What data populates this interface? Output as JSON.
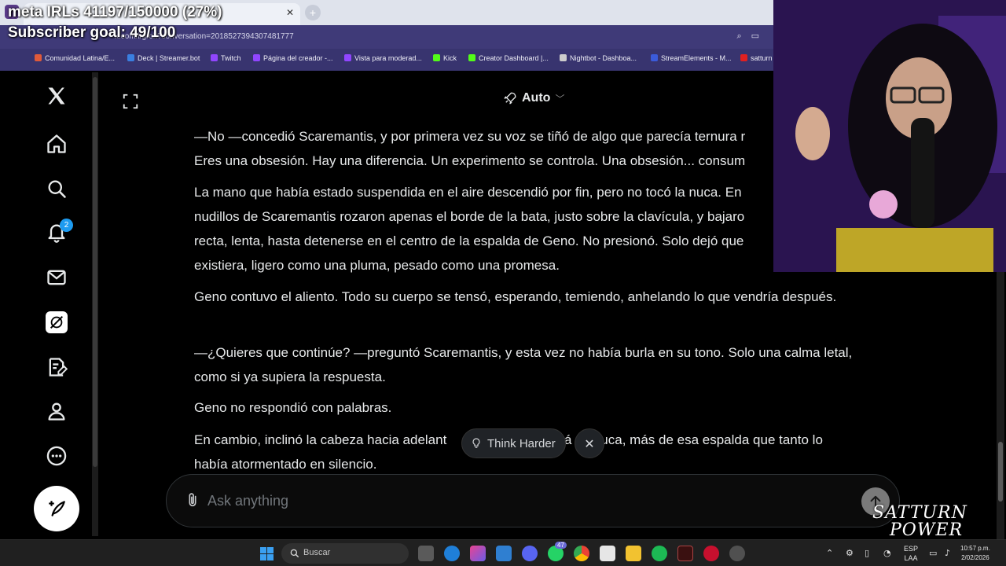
{
  "overlay": {
    "meta": "meta IRLs 41197/150000 (27%)",
    "subscriber_goal": "Subscriber goal: 49/100"
  },
  "browser": {
    "url": "x.com/i/grok?conversation=2018527394307481777",
    "bookmarks": [
      {
        "label": "Comunidad Latina/E...",
        "color": "#e05a3a"
      },
      {
        "label": "Deck | Streamer.bot",
        "color": "#3a7fe0"
      },
      {
        "label": "Twitch",
        "color": "#9146ff"
      },
      {
        "label": "Página del creador -...",
        "color": "#9146ff"
      },
      {
        "label": "Vista para moderad...",
        "color": "#9146ff"
      },
      {
        "label": "Kick",
        "color": "#53fc18"
      },
      {
        "label": "Creator Dashboard |...",
        "color": "#53fc18"
      },
      {
        "label": "Nightbot - Dashboa...",
        "color": "#cccccc"
      },
      {
        "label": "StreamElements - M...",
        "color": "#3b5bdb"
      },
      {
        "label": "satturn",
        "color": "#e02020"
      }
    ]
  },
  "sidebar": {
    "notifications_badge": "2",
    "items": [
      "x-logo",
      "home",
      "explore",
      "notifications",
      "messages",
      "grok",
      "lists",
      "profile",
      "more"
    ]
  },
  "header": {
    "model_label": "Auto"
  },
  "conversation": {
    "p1_line1": "—No —concedió Scaremantis, y por primera vez su voz se tiñó de algo que parecía ternura r",
    "p1_line2": "Eres una obsesión. Hay una diferencia. Un experimento se controla. Una obsesión... consum",
    "p2_line1": "La mano que había estado suspendida en el aire descendió por fin, pero no tocó la nuca. En",
    "p2_line2": "nudillos de Scaremantis rozaron apenas el borde de la bata, justo sobre la clavícula, y bajaro",
    "p2_line3": "recta, lenta, hasta detenerse en el centro de la espalda de Geno. No presionó. Solo dejó que",
    "p2_line4": "existiera, ligero como una pluma, pesado como una promesa.",
    "p3": "Geno contuvo el aliento. Todo su cuerpo se tensó, esperando, temiendo, anhelando lo que vendría después.",
    "p4": "—¿Quieres que continúe? —preguntó Scaremantis, y esta vez no había burla en su tono. Solo una calma letal, como si ya supiera la respuesta.",
    "p5": "Geno no respondió con palabras.",
    "p6_left": "En cambio, inclinó la cabeza hacia adelant",
    "p6_right": "á su nuca, más de esa espalda que tanto lo",
    "p6_line2": "había atormentado en silencio."
  },
  "suggestion": {
    "think_harder": "Think Harder"
  },
  "composer": {
    "placeholder": "Ask anything"
  },
  "logo": {
    "line1": "SATTURN",
    "line2": "POWER"
  },
  "taskbar": {
    "search_label": "Buscar",
    "whatsapp_badge": "47",
    "lang_line1": "ESP",
    "lang_line2": "LAA",
    "time": "10:57 p.m.",
    "date": "2/02/2026"
  }
}
